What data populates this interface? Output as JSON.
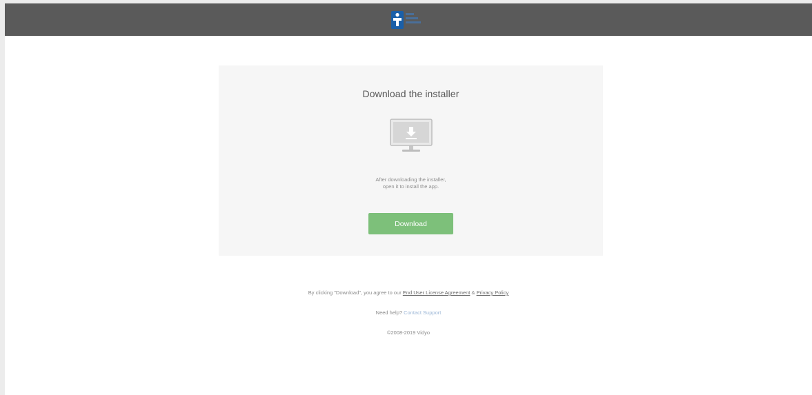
{
  "card": {
    "title": "Download the installer",
    "instructions_line1": "After downloading the installer,",
    "instructions_line2": "open it to install the app.",
    "download_label": "Download"
  },
  "footer": {
    "agree_prefix": "By clicking \"Download\", you agree to our ",
    "eula_link": "End User License Agreement",
    "agree_joiner": " & ",
    "privacy_link": "Privacy Policy",
    "help_prefix": "Need help? ",
    "support_link": "Contact Support",
    "copyright": "©2008-2019 Vidyo"
  },
  "colors": {
    "header_bg": "#5a5a5a",
    "card_bg": "#f6f6f6",
    "download_button": "#7dc07a",
    "logo_blue": "#1a5fa8",
    "support_link": "#9bb6d6"
  },
  "icons": {
    "logo": "vidyo-logo-icon",
    "monitor": "monitor-download-icon"
  }
}
